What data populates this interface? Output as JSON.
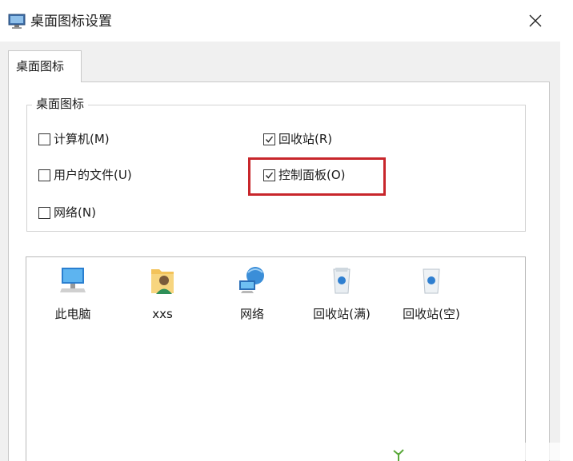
{
  "window": {
    "title": "桌面图标设置",
    "app_icon": "display-properties-icon",
    "close_icon": "close-icon"
  },
  "tabs": [
    {
      "label": "桌面图标",
      "selected": true
    }
  ],
  "desktop_icons_group": {
    "title": "桌面图标",
    "checkboxes": [
      {
        "label": "计算机(M)",
        "checked": false
      },
      {
        "label": "回收站(R)",
        "checked": true
      },
      {
        "label": "用户的文件(U)",
        "checked": false
      },
      {
        "label": "控制面板(O)",
        "checked": true,
        "highlighted": true
      },
      {
        "label": "网络(N)",
        "checked": false
      }
    ]
  },
  "icon_preview": {
    "items": [
      {
        "label": "此电脑",
        "icon": "computer-icon"
      },
      {
        "label": "xxs",
        "icon": "user-folder-icon"
      },
      {
        "label": "网络",
        "icon": "network-icon"
      },
      {
        "label": "回收站(满)",
        "icon": "recycle-bin-full-icon"
      },
      {
        "label": "回收站(空)",
        "icon": "recycle-bin-empty-icon"
      }
    ]
  },
  "colors": {
    "highlight_border": "#c8262b",
    "dialog_background": "#f0f0f0",
    "panel_background": "#ffffff"
  }
}
